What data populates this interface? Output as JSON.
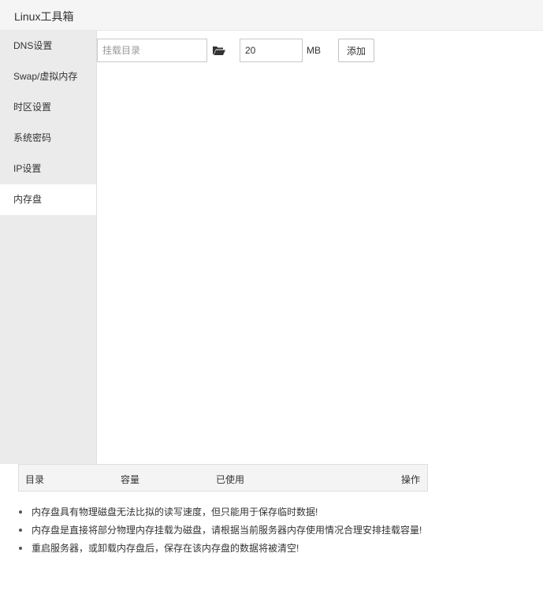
{
  "window": {
    "title": "Linux工具箱"
  },
  "sidebar": {
    "items": [
      {
        "label": "DNS设置"
      },
      {
        "label": "Swap/虚拟内存"
      },
      {
        "label": "时区设置"
      },
      {
        "label": "系统密码"
      },
      {
        "label": "IP设置"
      },
      {
        "label": "内存盘"
      }
    ],
    "active_index": 5
  },
  "toolbar": {
    "path_placeholder": "挂载目录",
    "path_value": "",
    "size_value": "20",
    "unit": "MB",
    "add_label": "添加",
    "folder_icon": "folder-open-icon"
  },
  "table": {
    "columns": [
      "目录",
      "容量",
      "已使用",
      "操作"
    ]
  },
  "tips": [
    "内存盘具有物理磁盘无法比拟的读写速度，但只能用于保存临时数据!",
    "内存盘是直接将部分物理内存挂载为磁盘，请根据当前服务器内存使用情况合理安排挂载容量!",
    "重启服务器，或卸载内存盘后，保存在该内存盘的数据将被清空!"
  ]
}
